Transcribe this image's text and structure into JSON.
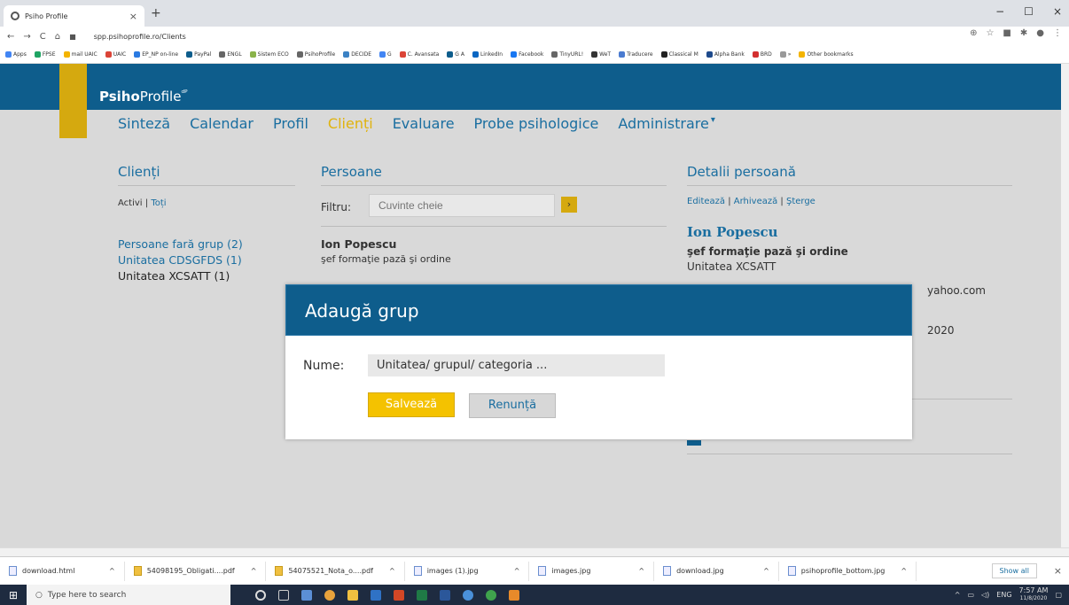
{
  "browser": {
    "tab_title": "Psiho Profile",
    "tab_close": "×",
    "new_tab": "+",
    "url": "spp.psihoprofile.ro/Clients",
    "window_controls": [
      "−",
      "☐",
      "×"
    ],
    "bookmarks": [
      "Apps",
      "FPSE",
      "mail UAIC",
      "UAIC",
      "EP_NP on-line",
      "PayPal",
      "ENGL",
      "Sistem ECO",
      "PsihoProfile",
      "DECIDE",
      "G",
      "C. Avansata",
      "G A",
      "LinkedIn",
      "Facebook",
      "TinyURL!",
      "WeT",
      "Traducere",
      "Classical M",
      "Alpha Bank",
      "BRD",
      "»",
      "Other bookmarks"
    ]
  },
  "app": {
    "logo_bold": "Psiho",
    "logo_rest": "Profile",
    "nav": [
      "Sinteză",
      "Calendar",
      "Profil",
      "Clienți",
      "Evaluare",
      "Probe psihologice",
      "Administrare"
    ],
    "nav_active_index": 3
  },
  "clients": {
    "title": "Clienți",
    "filter_active": "Activi",
    "separator": "|",
    "filter_all": "Toți",
    "groups": [
      "Persoane fară grup (2)",
      "Unitatea CDSGFDS (1)",
      "Unitatea XCSATT (1)"
    ]
  },
  "persons": {
    "title": "Persoane",
    "filter_label": "Filtru:",
    "filter_placeholder": "Cuvinte cheie",
    "filter_button": "›",
    "items": [
      {
        "name": "Ion Popescu",
        "role": "şef formaţie pază şi ordine"
      }
    ]
  },
  "details": {
    "title": "Detalii persoană",
    "action_edit": "Editează",
    "action_archive": "Arhivează",
    "action_delete": "Şterge",
    "name": "Ion Popescu",
    "role": "şef formaţie pază şi ordine",
    "unit": "Unitatea XCSATT",
    "email_partial": "yahoo.com",
    "year_partial": "2020"
  },
  "modal": {
    "title": "Adaugă grup",
    "label": "Nume:",
    "input_value": "Unitatea/ grupul/ categoria ...",
    "save": "Salvează",
    "cancel": "Renunță"
  },
  "downloads": {
    "items": [
      "download.html",
      "54098195_Obligati....pdf",
      "54075521_Nota_o....pdf",
      "images (1).jpg",
      "images.jpg",
      "download.jpg",
      "psihoprofile_bottom.jpg"
    ],
    "show_all": "Show all",
    "close": "×"
  },
  "taskbar": {
    "search_placeholder": "Type here to search",
    "time": "7:57 AM",
    "date": "11/8/2020",
    "lang": "ENG"
  },
  "colors": {
    "brand_blue": "#0e5d8c",
    "gold": "#d5a90f",
    "link_blue": "#1a6ea0"
  }
}
